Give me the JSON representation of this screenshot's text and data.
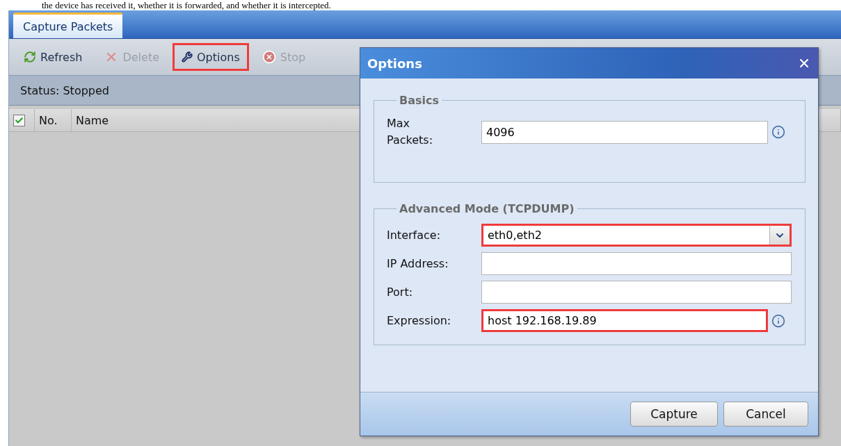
{
  "document_text": "the device has received it, whether it is forwarded, and whether it is intercepted.",
  "panel": {
    "tabs": [
      {
        "label": "Capture Packets",
        "selected": true
      }
    ],
    "toolbar": [
      {
        "label": "Refresh",
        "kind": "refresh",
        "disabled": false,
        "highlighted": false
      },
      {
        "label": "Delete",
        "kind": "delete",
        "disabled": true,
        "highlighted": false
      },
      {
        "label": "Options",
        "kind": "settings",
        "disabled": false,
        "highlighted": true
      },
      {
        "label": "Stop",
        "kind": "stop",
        "disabled": true,
        "highlighted": false
      }
    ],
    "status": "Status: Stopped",
    "grid": {
      "select_all_checked": true,
      "columns": [
        "No.",
        "Name"
      ]
    }
  },
  "dialog": {
    "title": "Options",
    "sections": [
      {
        "legend": "Basics",
        "fields": [
          {
            "kind": "text",
            "label": "Max Packets:",
            "value": "4096",
            "info": true,
            "highlighted": false
          }
        ]
      },
      {
        "legend": "Advanced Mode (TCPDUMP)",
        "fields": [
          {
            "kind": "select",
            "label": "Interface:",
            "value": "eth0,eth2",
            "info": false,
            "highlighted": true
          },
          {
            "kind": "text",
            "label": "IP Address:",
            "info": false,
            "highlighted": false
          },
          {
            "kind": "text",
            "label": "Port:",
            "info": false,
            "highlighted": false
          },
          {
            "kind": "text",
            "label": "Expression:",
            "value": "host 192.168.19.89",
            "info": true,
            "highlighted": true
          }
        ]
      }
    ],
    "buttons": [
      "Capture",
      "Cancel"
    ]
  }
}
